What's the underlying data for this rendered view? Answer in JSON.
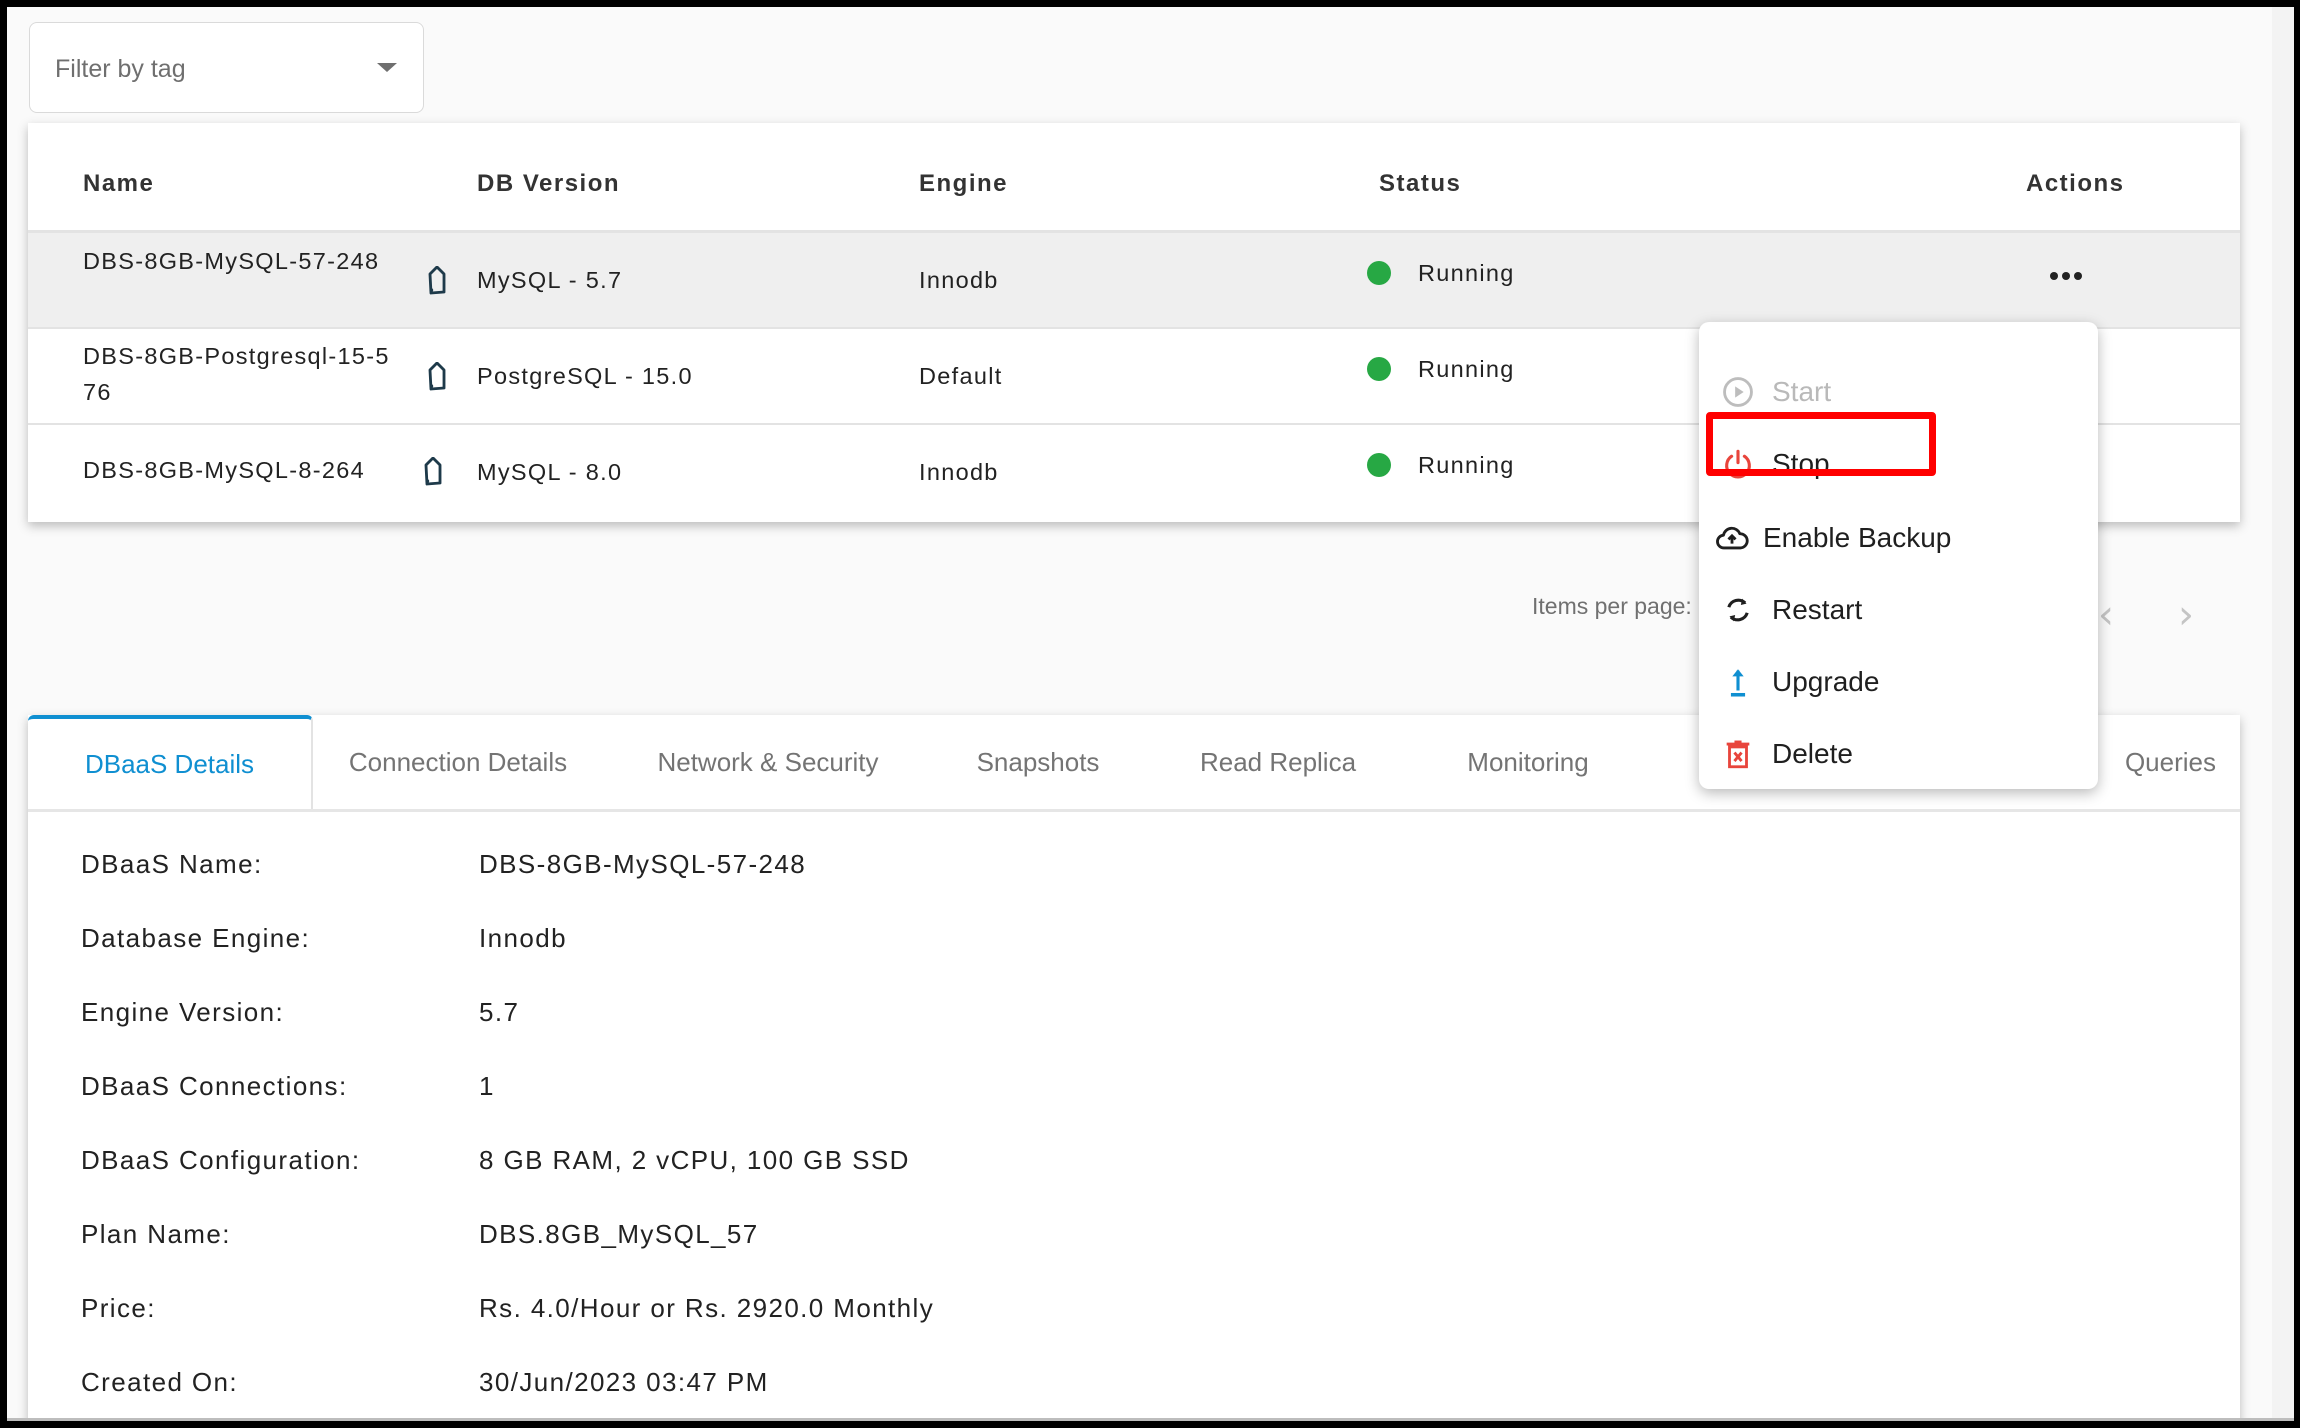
{
  "filter": {
    "placeholder": "Filter by tag"
  },
  "table": {
    "headers": [
      "Name",
      "DB Version",
      "Engine",
      "Status",
      "Actions"
    ],
    "rows": [
      {
        "name": "DBS-8GB-MySQL-57-248",
        "db_version": "MySQL - 5.7",
        "engine": "Innodb",
        "status": "Running",
        "selected": true
      },
      {
        "name": "DBS-8GB-Postgresql-15-576",
        "db_version": "PostgreSQL - 15.0",
        "engine": "Default",
        "status": "Running",
        "selected": false
      },
      {
        "name": "DBS-8GB-MySQL-8-264",
        "db_version": "MySQL - 8.0",
        "engine": "Innodb",
        "status": "Running",
        "selected": false
      }
    ],
    "status_color": "#27a844"
  },
  "pagination": {
    "items_per_page_label": "Items per page:",
    "prev": "‹",
    "next": "›"
  },
  "actions_menu": {
    "items": [
      {
        "label": "Start",
        "icon": "play-circle-icon",
        "disabled": true
      },
      {
        "label": "Stop",
        "icon": "power-icon",
        "disabled": false,
        "highlighted": true
      },
      {
        "label": "Enable Backup",
        "icon": "cloud-upload-icon",
        "disabled": false
      },
      {
        "label": "Restart",
        "icon": "refresh-icon",
        "disabled": false
      },
      {
        "label": "Upgrade",
        "icon": "upload-arrow-icon",
        "disabled": false
      },
      {
        "label": "Delete",
        "icon": "trash-icon",
        "disabled": false
      }
    ],
    "highlight_color": "#ff0000"
  },
  "tabs": [
    {
      "label": "DBaaS Details",
      "active": true
    },
    {
      "label": "Connection Details",
      "active": false
    },
    {
      "label": "Network & Security",
      "active": false
    },
    {
      "label": "Snapshots",
      "active": false
    },
    {
      "label": "Read Replica",
      "active": false
    },
    {
      "label": "Monitoring",
      "active": false
    },
    {
      "label": "Queries",
      "active": false,
      "partially_hidden": true
    }
  ],
  "details": [
    {
      "label": "DBaaS Name:",
      "value": "DBS-8GB-MySQL-57-248"
    },
    {
      "label": "Database Engine:",
      "value": "Innodb"
    },
    {
      "label": "Engine Version:",
      "value": "5.7"
    },
    {
      "label": "DBaaS Connections:",
      "value": "1"
    },
    {
      "label": "DBaaS Configuration:",
      "value": "8 GB RAM, 2 vCPU, 100 GB SSD"
    },
    {
      "label": "Plan Name:",
      "value": "DBS.8GB_MySQL_57"
    },
    {
      "label": "Price:",
      "value": "Rs. 4.0/Hour or Rs. 2920.0 Monthly"
    },
    {
      "label": "Created On:",
      "value": "30/Jun/2023 03:47 PM"
    }
  ],
  "colors": {
    "accent": "#0f8fd1",
    "danger": "#e8453c",
    "running": "#27a844"
  }
}
